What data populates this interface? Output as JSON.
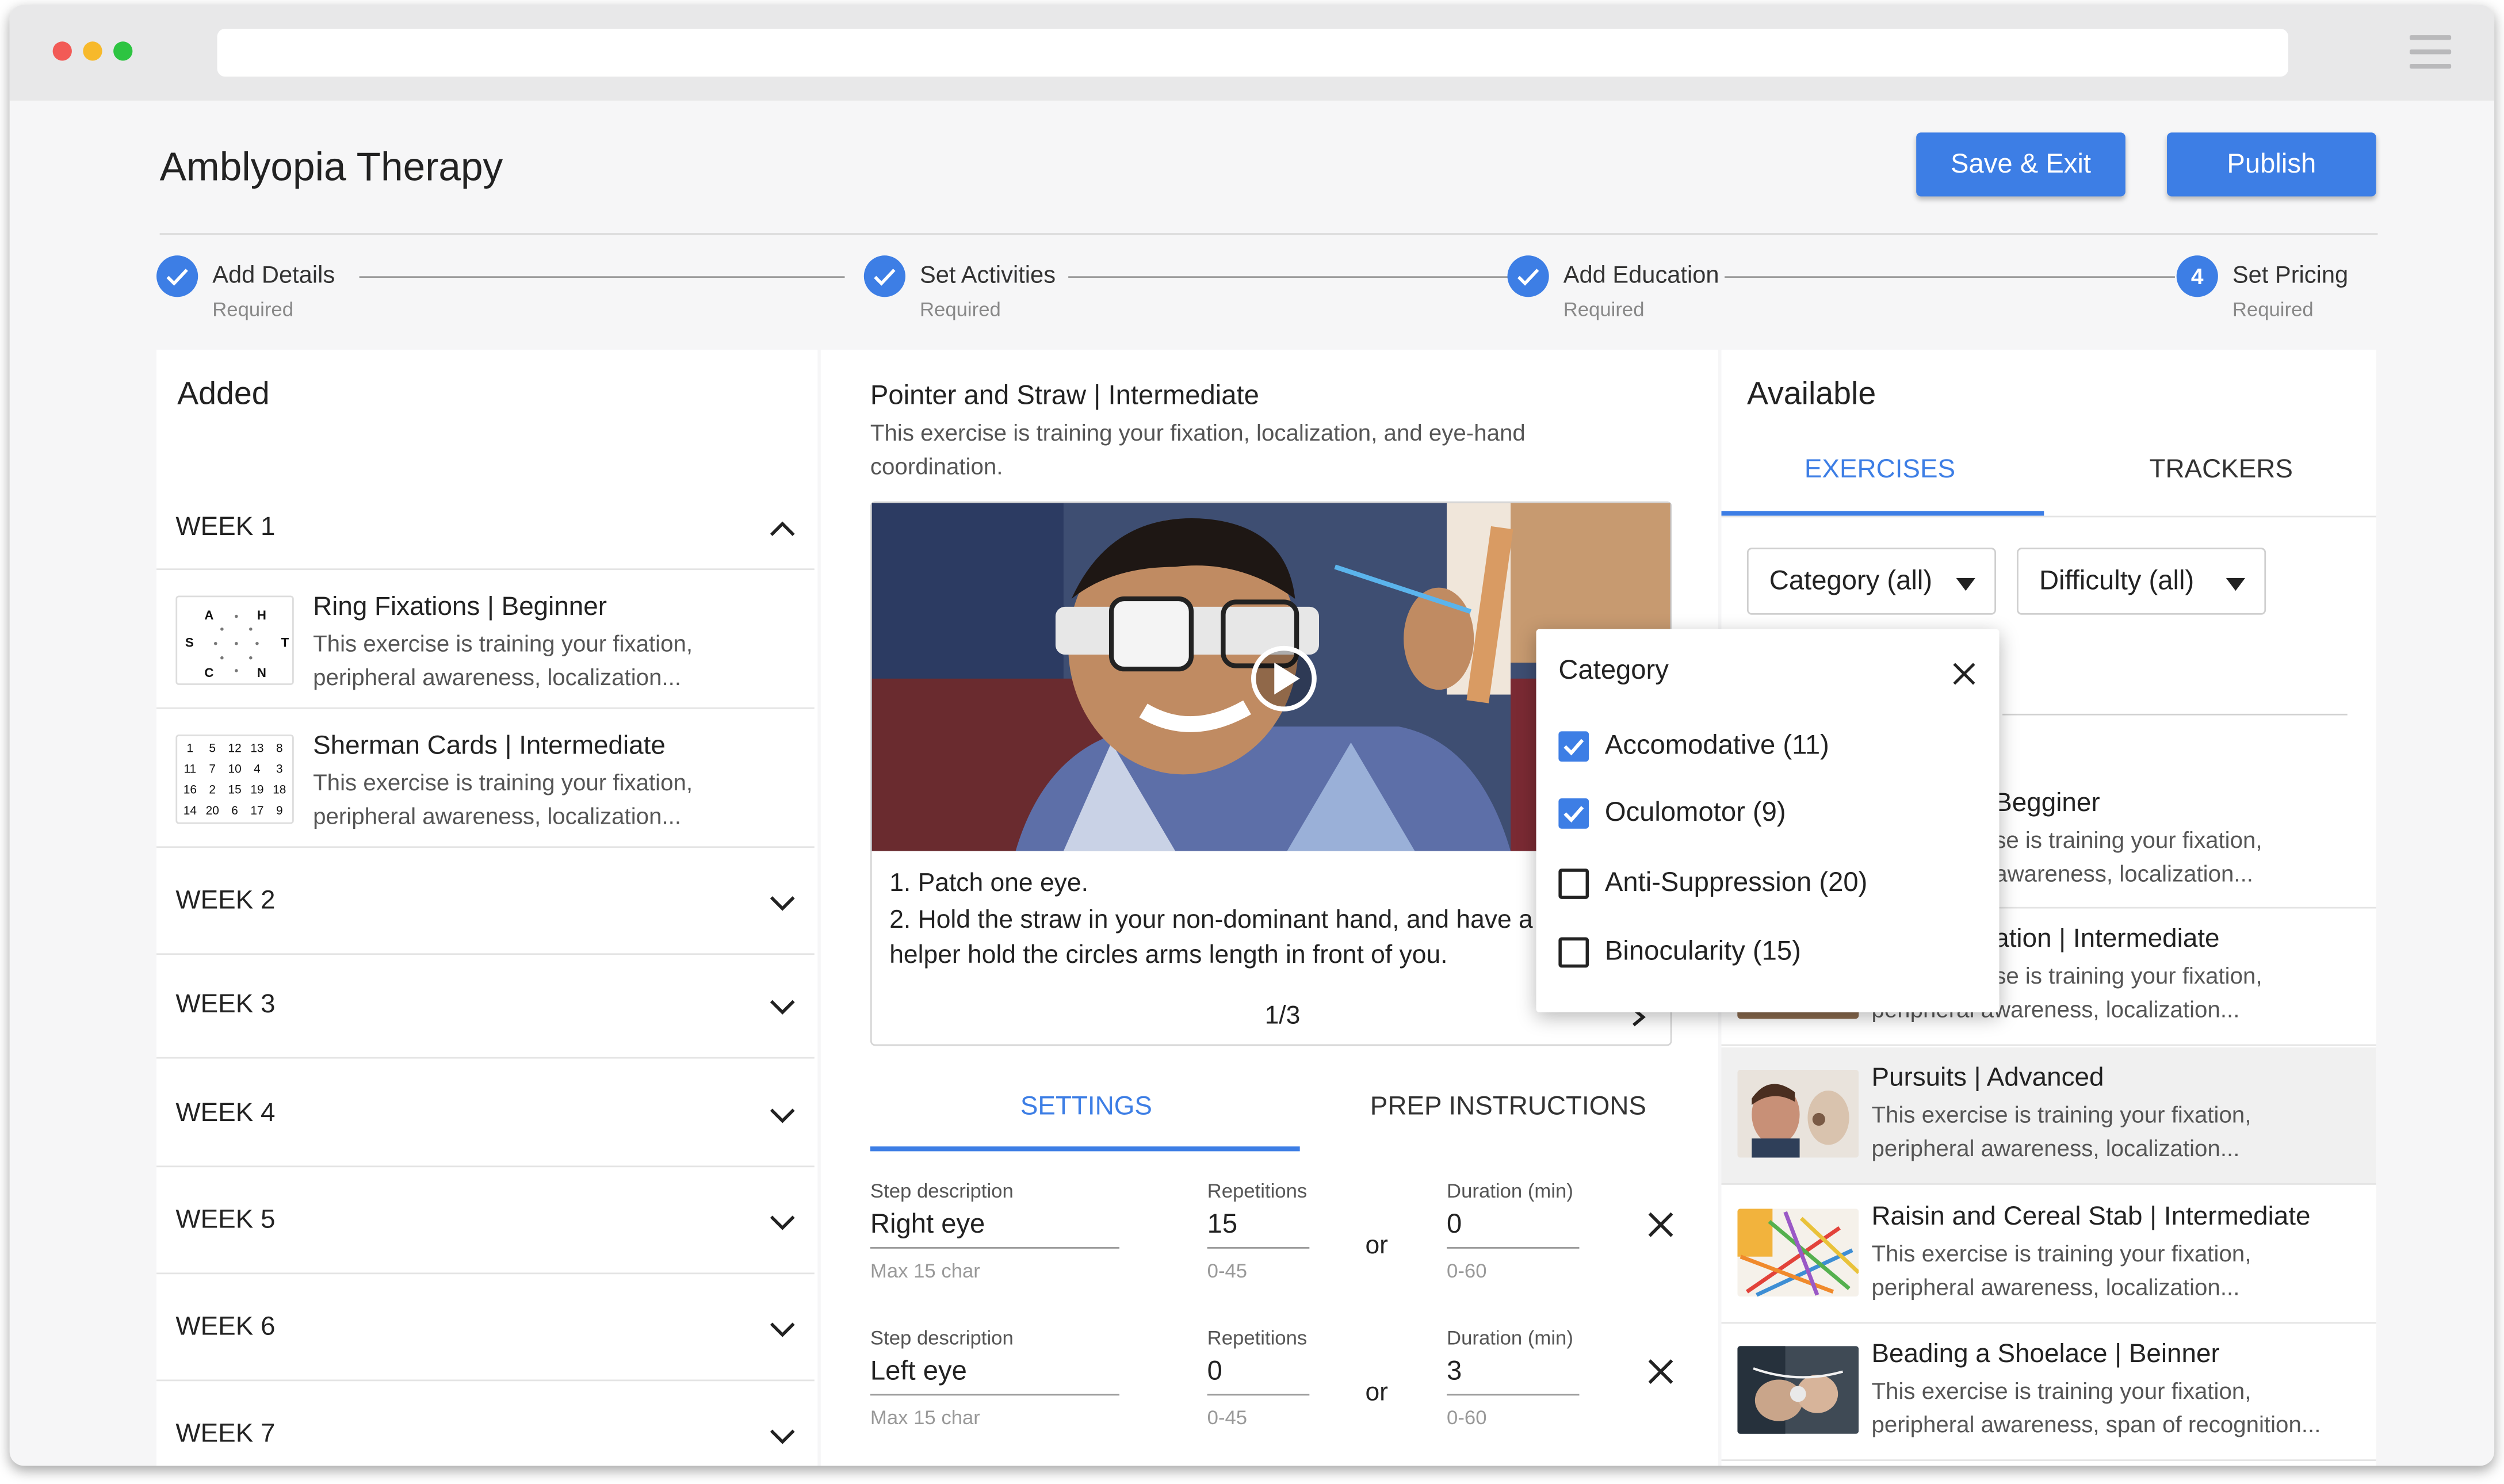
{
  "app": {
    "title": "Amblyopia Therapy"
  },
  "header": {
    "save_exit": "Save & Exit",
    "publish": "Publish"
  },
  "stepper": [
    {
      "label": "Add Details",
      "sub": "Required",
      "marker": "check-icon"
    },
    {
      "label": "Set Activities",
      "sub": "Required",
      "marker": "check-icon"
    },
    {
      "label": "Add Education",
      "sub": "Required",
      "marker": "check-icon"
    },
    {
      "label": "Set Pricing",
      "sub": "Required",
      "marker": "4"
    }
  ],
  "added": {
    "title": "Added",
    "weeks": [
      "WEEK 1",
      "WEEK 2",
      "WEEK 3",
      "WEEK 4",
      "WEEK 5",
      "WEEK 6",
      "WEEK 7"
    ],
    "items": [
      {
        "title": "Ring Fixations | Beginner",
        "desc": "This exercise is training your fixation, peripheral awareness, localization...",
        "thumb_letters": [
          "A",
          "H",
          "S",
          "T",
          "C",
          "N"
        ]
      },
      {
        "title": "Sherman Cards | Intermediate",
        "desc": "This exercise is training your fixation, peripheral awareness, localization...",
        "thumb_numbers": [
          "1",
          "5",
          "12",
          "13",
          "8",
          "11",
          "7",
          "10",
          "4",
          "3",
          "16",
          "2",
          "15",
          "19",
          "18",
          "14",
          "20",
          "6",
          "17",
          "9"
        ]
      }
    ]
  },
  "detail": {
    "title": "Pointer and Straw | Intermediate",
    "desc": "This exercise is training your fixation, localization, and eye-hand coordination.",
    "step1": "1. Patch one eye.",
    "step2": "2. Hold the straw in your non-dominant hand, and have a",
    "step3": "helper hold the circles arms length in front of you.",
    "pager": "1/3",
    "tabs": {
      "settings": "SETTINGS",
      "prep": "PREP INSTRUCTIONS"
    },
    "rows": [
      {
        "step_label": "Step description",
        "step_value": "Right eye",
        "step_hint": "Max 15 char",
        "rep_label": "Repetitions",
        "rep_value": "15",
        "rep_hint": "0-45",
        "or": "or",
        "dur_label": "Duration (min)",
        "dur_value": "0",
        "dur_hint": "0-60"
      },
      {
        "step_label": "Step description",
        "step_value": "Left eye",
        "step_hint": "Max 15 char",
        "rep_label": "Repetitions",
        "rep_value": "0",
        "rep_hint": "0-45",
        "or": "or",
        "dur_label": "Duration (min)",
        "dur_value": "3",
        "dur_hint": "0-60"
      }
    ]
  },
  "available": {
    "title": "Available",
    "tabs": {
      "exercises": "EXERCISES",
      "trackers": "TRACKERS"
    },
    "filters": {
      "category": "Category (all)",
      "difficulty": "Difficulty (all)"
    },
    "items": [
      {
        "title": "Begginer",
        "desc1": "se is training your fixation,",
        "desc2": "awareness, localization..."
      },
      {
        "title": "ation | Intermediate",
        "desc1": "se is training your fixation,",
        "desc2": "peripheral awareness, localization..."
      },
      {
        "title": "Pursuits | Advanced",
        "desc": "This exercise is training your fixation, peripheral awareness, localization..."
      },
      {
        "title": "Raisin and Cereal Stab | Intermediate",
        "desc": "This exercise is training your fixation, peripheral awareness, localization..."
      },
      {
        "title": "Beading a Shoelace | Beinner",
        "desc": "This exercise is training your fixation, peripheral awareness, span of recognition..."
      }
    ]
  },
  "category_dropdown": {
    "title": "Category",
    "options": [
      {
        "label": "Accomodative (11)",
        "checked": true
      },
      {
        "label": "Oculomotor (9)",
        "checked": true
      },
      {
        "label": "Anti-Suppression (20)",
        "checked": false
      },
      {
        "label": "Binocularity (15)",
        "checked": false
      }
    ]
  },
  "colors": {
    "accent": "#3d7ee5",
    "window_bg": "#f6f6f7",
    "chrome": "#e8e8e9",
    "dot_red": "#f25a56",
    "dot_yellow": "#f7b92b",
    "dot_green": "#2dc441"
  }
}
